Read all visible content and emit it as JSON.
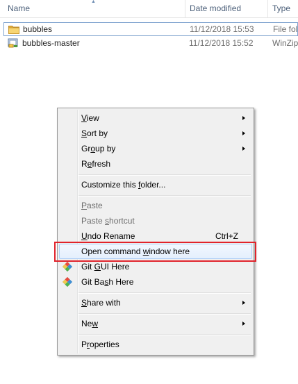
{
  "header": {
    "name": "Name",
    "date_modified": "Date modified",
    "type": "Type"
  },
  "files": [
    {
      "name": "bubbles",
      "date": "11/12/2018 15:53",
      "type": "File fol",
      "icon": "folder-icon"
    },
    {
      "name": "bubbles-master",
      "date": "11/12/2018 15:52",
      "type": "WinZip",
      "icon": "zip-file-icon"
    }
  ],
  "menu": {
    "view": {
      "pre": "",
      "u": "V",
      "post": "iew"
    },
    "sort_by": {
      "pre": "",
      "u": "S",
      "post": "ort by"
    },
    "group_by": {
      "pre": "Gr",
      "u": "o",
      "post": "up by"
    },
    "refresh": {
      "pre": "R",
      "u": "e",
      "post": "fresh"
    },
    "customize": {
      "pre": "Customize this ",
      "u": "f",
      "post": "older..."
    },
    "paste": {
      "pre": "",
      "u": "P",
      "post": "aste"
    },
    "paste_shortcut": {
      "pre": "Paste ",
      "u": "s",
      "post": "hortcut"
    },
    "undo_rename": {
      "pre": "",
      "u": "U",
      "post": "ndo Rename"
    },
    "undo_shortcut": "Ctrl+Z",
    "open_cmd": {
      "pre": "Open command ",
      "u": "w",
      "post": "indow here"
    },
    "git_gui": {
      "pre": "Git ",
      "u": "G",
      "post": "UI Here"
    },
    "git_bash": {
      "pre": "Git Ba",
      "u": "s",
      "post": "h Here"
    },
    "share_with": {
      "pre": "",
      "u": "S",
      "post": "hare with"
    },
    "new": {
      "pre": "Ne",
      "u": "w",
      "post": ""
    },
    "properties": {
      "pre": "P",
      "u": "r",
      "post": "operties"
    }
  },
  "colors": {
    "highlight_border": "#e1232b",
    "header_text": "#4c607a",
    "hover_border": "#aecff7"
  }
}
